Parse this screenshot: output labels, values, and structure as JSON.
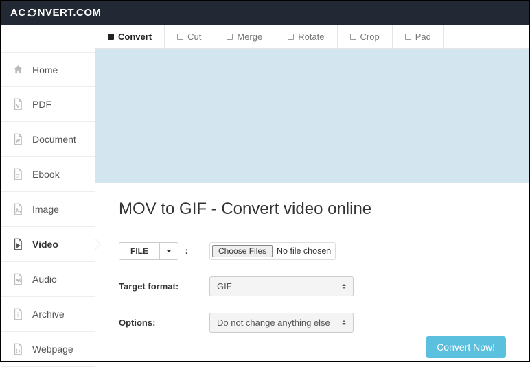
{
  "logo": {
    "pre": "AC",
    "post": "NVERT.COM"
  },
  "sidebar": {
    "items": [
      {
        "label": "Home"
      },
      {
        "label": "PDF"
      },
      {
        "label": "Document"
      },
      {
        "label": "Ebook"
      },
      {
        "label": "Image"
      },
      {
        "label": "Video"
      },
      {
        "label": "Audio"
      },
      {
        "label": "Archive"
      },
      {
        "label": "Webpage"
      }
    ]
  },
  "tabs": [
    {
      "label": "Convert"
    },
    {
      "label": "Cut"
    },
    {
      "label": "Merge"
    },
    {
      "label": "Rotate"
    },
    {
      "label": "Crop"
    },
    {
      "label": "Pad"
    }
  ],
  "page": {
    "title": "MOV to GIF - Convert video online",
    "file_button": "FILE",
    "choose_files": "Choose Files",
    "no_file": "No file chosen",
    "target_label": "Target format:",
    "target_value": "GIF",
    "options_label": "Options:",
    "options_value": "Do not change anything else",
    "convert_button": "Convert Now!"
  }
}
